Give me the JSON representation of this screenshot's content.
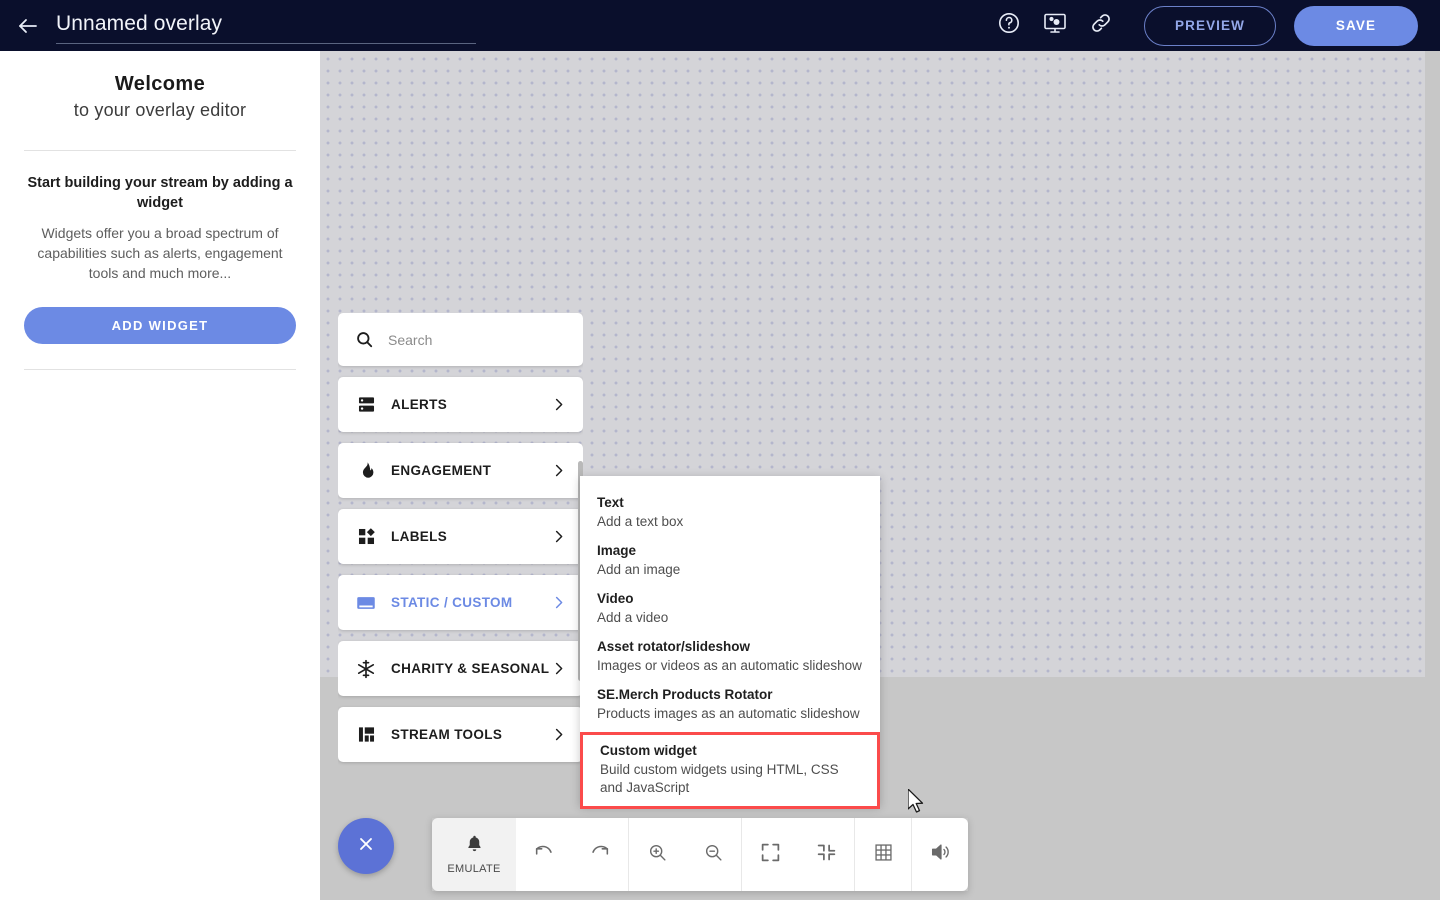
{
  "header": {
    "back_icon": "arrow-left-icon",
    "title_value": "Unnamed overlay",
    "title_placeholder": "Overlay name",
    "help_icon": "help-circle-icon",
    "display_icon": "monitor-settings-icon",
    "link_icon": "link-icon",
    "preview_label": "PREVIEW",
    "save_label": "SAVE",
    "bg_color": "#0a0f2c",
    "accent_color": "#6c8ae4"
  },
  "sidebar": {
    "welcome_line1": "Welcome",
    "welcome_line2": "to your overlay editor",
    "heading": "Start building your stream by adding a widget",
    "body": "Widgets offer you a broad spectrum of capabilities such as alerts, engagement tools and much more...",
    "add_widget_label": "ADD WIDGET"
  },
  "widget_panel": {
    "search_placeholder": "Search",
    "search_value": "",
    "categories": [
      {
        "label": "ALERTS",
        "icon": "server-stack-icon",
        "active": false
      },
      {
        "label": "ENGAGEMENT",
        "icon": "flame-icon",
        "active": false
      },
      {
        "label": "LABELS",
        "icon": "label-blocks-icon",
        "active": false
      },
      {
        "label": "STATIC / CUSTOM",
        "icon": "static-panel-icon",
        "active": true
      },
      {
        "label": "CHARITY & SEASONAL",
        "icon": "snowflake-icon",
        "active": false
      },
      {
        "label": "STREAM TOOLS",
        "icon": "bar-blocks-icon",
        "active": false
      }
    ]
  },
  "submenu": {
    "items": [
      {
        "title": "Text",
        "desc": "Add a text box",
        "highlighted": false
      },
      {
        "title": "Image",
        "desc": "Add an image",
        "highlighted": false
      },
      {
        "title": "Video",
        "desc": "Add a video",
        "highlighted": false
      },
      {
        "title": "Asset rotator/slideshow",
        "desc": "Images or videos as an automatic slideshow",
        "highlighted": false
      },
      {
        "title": "SE.Merch Products Rotator",
        "desc": "Products images as an automatic slideshow",
        "highlighted": false
      },
      {
        "title": "Custom widget",
        "desc": "Build custom widgets using HTML, CSS and JavaScript",
        "highlighted": true
      }
    ],
    "highlight_color": "#fb4b4b"
  },
  "toolbar": {
    "close_icon": "close-x-icon",
    "emulate_icon": "bell-icon",
    "emulate_label": "EMULATE",
    "buttons": [
      {
        "name": "undo-icon"
      },
      {
        "name": "redo-icon"
      },
      {
        "name": "zoom-in-icon"
      },
      {
        "name": "zoom-out-icon"
      },
      {
        "name": "fullscreen-expand-icon"
      },
      {
        "name": "fullscreen-collapse-icon"
      },
      {
        "name": "grid-icon"
      },
      {
        "name": "volume-icon"
      }
    ]
  },
  "canvas": {
    "background": "#d4d4d8",
    "dot_color": "#b4b6cc"
  }
}
